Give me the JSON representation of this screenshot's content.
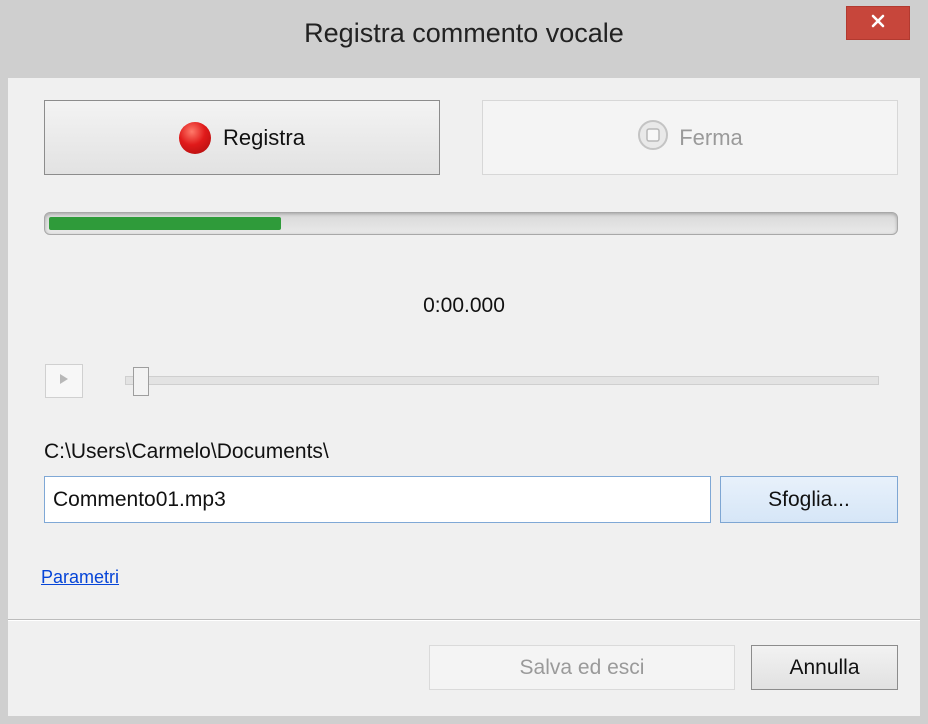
{
  "window": {
    "title": "Registra commento vocale"
  },
  "record_controls": {
    "record_label": "Registra",
    "stop_label": "Ferma"
  },
  "recording": {
    "level_fraction": 0.275,
    "level_color": "#2f9b3a",
    "elapsed": "0:00.000"
  },
  "playback": {
    "position_fraction": 0.01
  },
  "output": {
    "folder": "C:\\Users\\Carmelo\\Documents\\",
    "filename": "Commento01.mp3",
    "browse_label": "Sfoglia...",
    "parameters_link": "Parametri"
  },
  "footer": {
    "save_label": "Salva ed esci",
    "cancel_label": "Annulla"
  },
  "icons": {
    "close": "close-icon",
    "record": "record-icon",
    "stop": "stop-icon",
    "play": "play-icon"
  },
  "colors": {
    "close_button": "#c7463b",
    "record_dot": "#e01a1a",
    "link": "#0645d8"
  }
}
